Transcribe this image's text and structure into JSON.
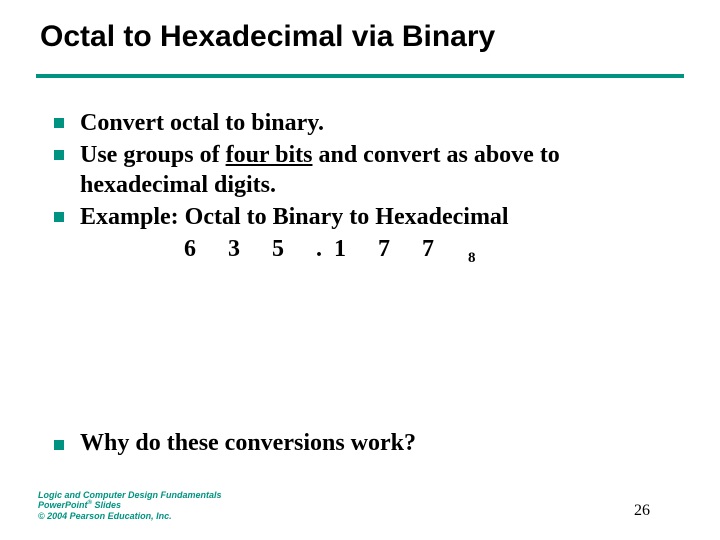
{
  "title": "Octal to Hexadecimal via Binary",
  "bullets": {
    "b1": "Convert octal to binary.",
    "b2a": "Use groups of ",
    "b2u": "four bits",
    "b2b": " and convert as above to hexadecimal digits.",
    "b3": "Example: Octal to Binary to Hexadecimal",
    "last": "Why do these conversions work?"
  },
  "example": {
    "d1": "6",
    "d2": "3",
    "d3": "5",
    "dot": ".",
    "d4": "1",
    "d5": "7",
    "d6": "7",
    "sub": "8"
  },
  "footer": {
    "line1a": "Logic and Computer Design Fundamentals",
    "line2a": "PowerPoint",
    "line2sup": "®",
    "line2b": " Slides",
    "line3": "© 2004 Pearson Education, Inc."
  },
  "page": "26"
}
